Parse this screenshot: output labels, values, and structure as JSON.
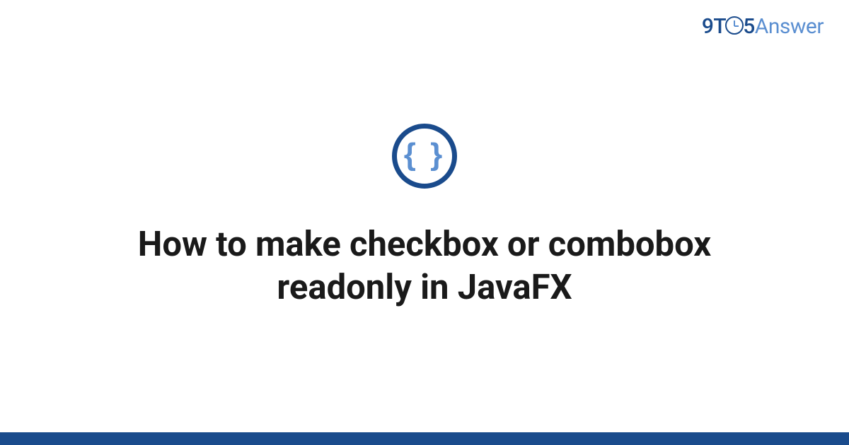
{
  "logo": {
    "part1": "9T",
    "part2": "5",
    "part3": "Answer"
  },
  "icon": {
    "name": "code-braces-icon",
    "glyph": "{ }"
  },
  "title": "How to make checkbox or combobox readonly in JavaFX",
  "colors": {
    "primary": "#1a4b8c",
    "secondary": "#5b8fd1"
  }
}
